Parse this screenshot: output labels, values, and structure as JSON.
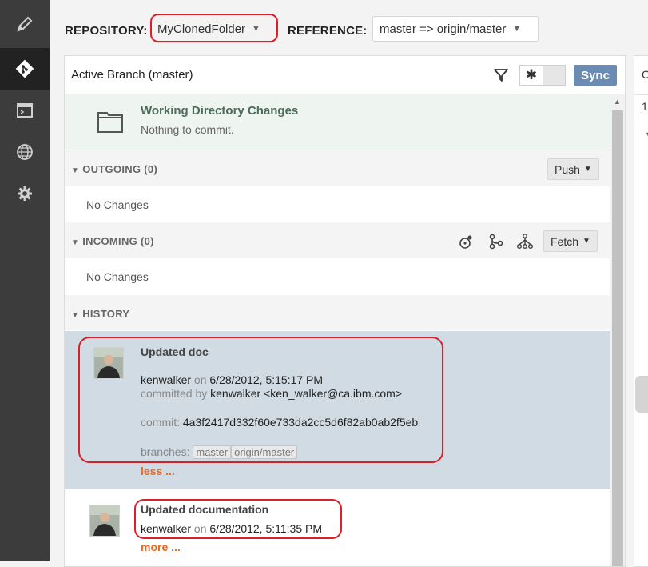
{
  "toolbar": {
    "repository_label": "REPOSITORY:",
    "repository_value": "MyClonedFolder",
    "reference_label": "REFERENCE:",
    "reference_value": "master => origin/master"
  },
  "nav": {
    "items": [
      {
        "icon": "pencil-icon",
        "active": false
      },
      {
        "icon": "git-icon",
        "active": true
      },
      {
        "icon": "terminal-icon",
        "active": false
      },
      {
        "icon": "globe-icon",
        "active": false
      },
      {
        "icon": "gear-icon",
        "active": false
      }
    ]
  },
  "panel": {
    "title": "Active Branch (master)",
    "sync_label": "Sync",
    "toggle_symbol": "✱"
  },
  "working_directory": {
    "title": "Working Directory Changes",
    "subtitle": "Nothing to commit."
  },
  "outgoing": {
    "title": "OUTGOING (0)",
    "button_label": "Push",
    "empty_text": "No Changes"
  },
  "incoming": {
    "title": "INCOMING (0)",
    "button_label": "Fetch",
    "empty_text": "No Changes"
  },
  "history": {
    "title": "HISTORY",
    "commits": [
      {
        "title": "Updated doc",
        "author": "kenwalker",
        "on_label": "on",
        "date": "6/28/2012, 5:15:17 PM",
        "committed_by_label": "committed by",
        "committer": "kenwalker <ken_walker@ca.ibm.com>",
        "commit_label": "commit:",
        "hash": "4a3f2417d332f60e733da2cc5d6f82ab0ab2f5eb",
        "branches_label": "branches:",
        "branches": [
          "master",
          "origin/master"
        ],
        "toggle": "less ..."
      },
      {
        "title": "Updated documentation",
        "author": "kenwalker",
        "on_label": "on",
        "date": "6/28/2012, 5:11:35 PM",
        "toggle": "more ..."
      }
    ]
  },
  "right_panel": {
    "a": "C",
    "b": "1"
  },
  "colors": {
    "accent": "#6b8bb3",
    "highlight": "#d9202a",
    "link": "#e66a24",
    "selected_row": "#d1dbe3"
  }
}
